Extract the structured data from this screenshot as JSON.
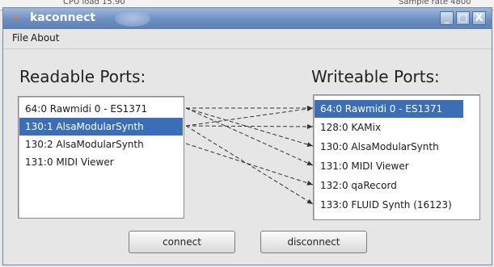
{
  "background": {
    "left_text": "CPU load 15.90",
    "right_text": "Sample rate 4800"
  },
  "window": {
    "title": "kaconnect",
    "title_icon": "kde-gear-icon",
    "controls": {
      "minimize": "_",
      "maximize": "□",
      "close": "X"
    }
  },
  "menu": {
    "items": [
      {
        "label": "File"
      },
      {
        "label": "About"
      }
    ]
  },
  "readable": {
    "heading": "Readable Ports:",
    "ports": [
      {
        "label": "64:0 Rawmidi 0 - ES1371",
        "selected": false
      },
      {
        "label": "130:1 AlsaModularSynth",
        "selected": true
      },
      {
        "label": "130:2 AlsaModularSynth",
        "selected": false
      },
      {
        "label": "131:0 MIDI Viewer",
        "selected": false
      }
    ]
  },
  "writeable": {
    "heading": "Writeable Ports:",
    "ports": [
      {
        "label": "64:0 Rawmidi 0 - ES1371",
        "selected": true
      },
      {
        "label": "128:0 KAMix",
        "selected": false
      },
      {
        "label": "130:0 AlsaModularSynth",
        "selected": false
      },
      {
        "label": "131:0 MIDI Viewer",
        "selected": false
      },
      {
        "label": "132:0 qaRecord",
        "selected": false
      },
      {
        "label": "133:0 FLUID Synth (16123)",
        "selected": false
      }
    ]
  },
  "connections": [
    {
      "from": 0,
      "to": 0
    },
    {
      "from": 0,
      "to": 2
    },
    {
      "from": 0,
      "to": 3
    },
    {
      "from": 1,
      "to": 0
    },
    {
      "from": 1,
      "to": 1
    },
    {
      "from": 1,
      "to": 5
    },
    {
      "from": 2,
      "to": 4
    }
  ],
  "buttons": {
    "connect": "connect",
    "disconnect": "disconnect"
  },
  "colors": {
    "selection": "#3a6fb8",
    "titlebar": "#6c8ec0",
    "connector": "#333333"
  }
}
